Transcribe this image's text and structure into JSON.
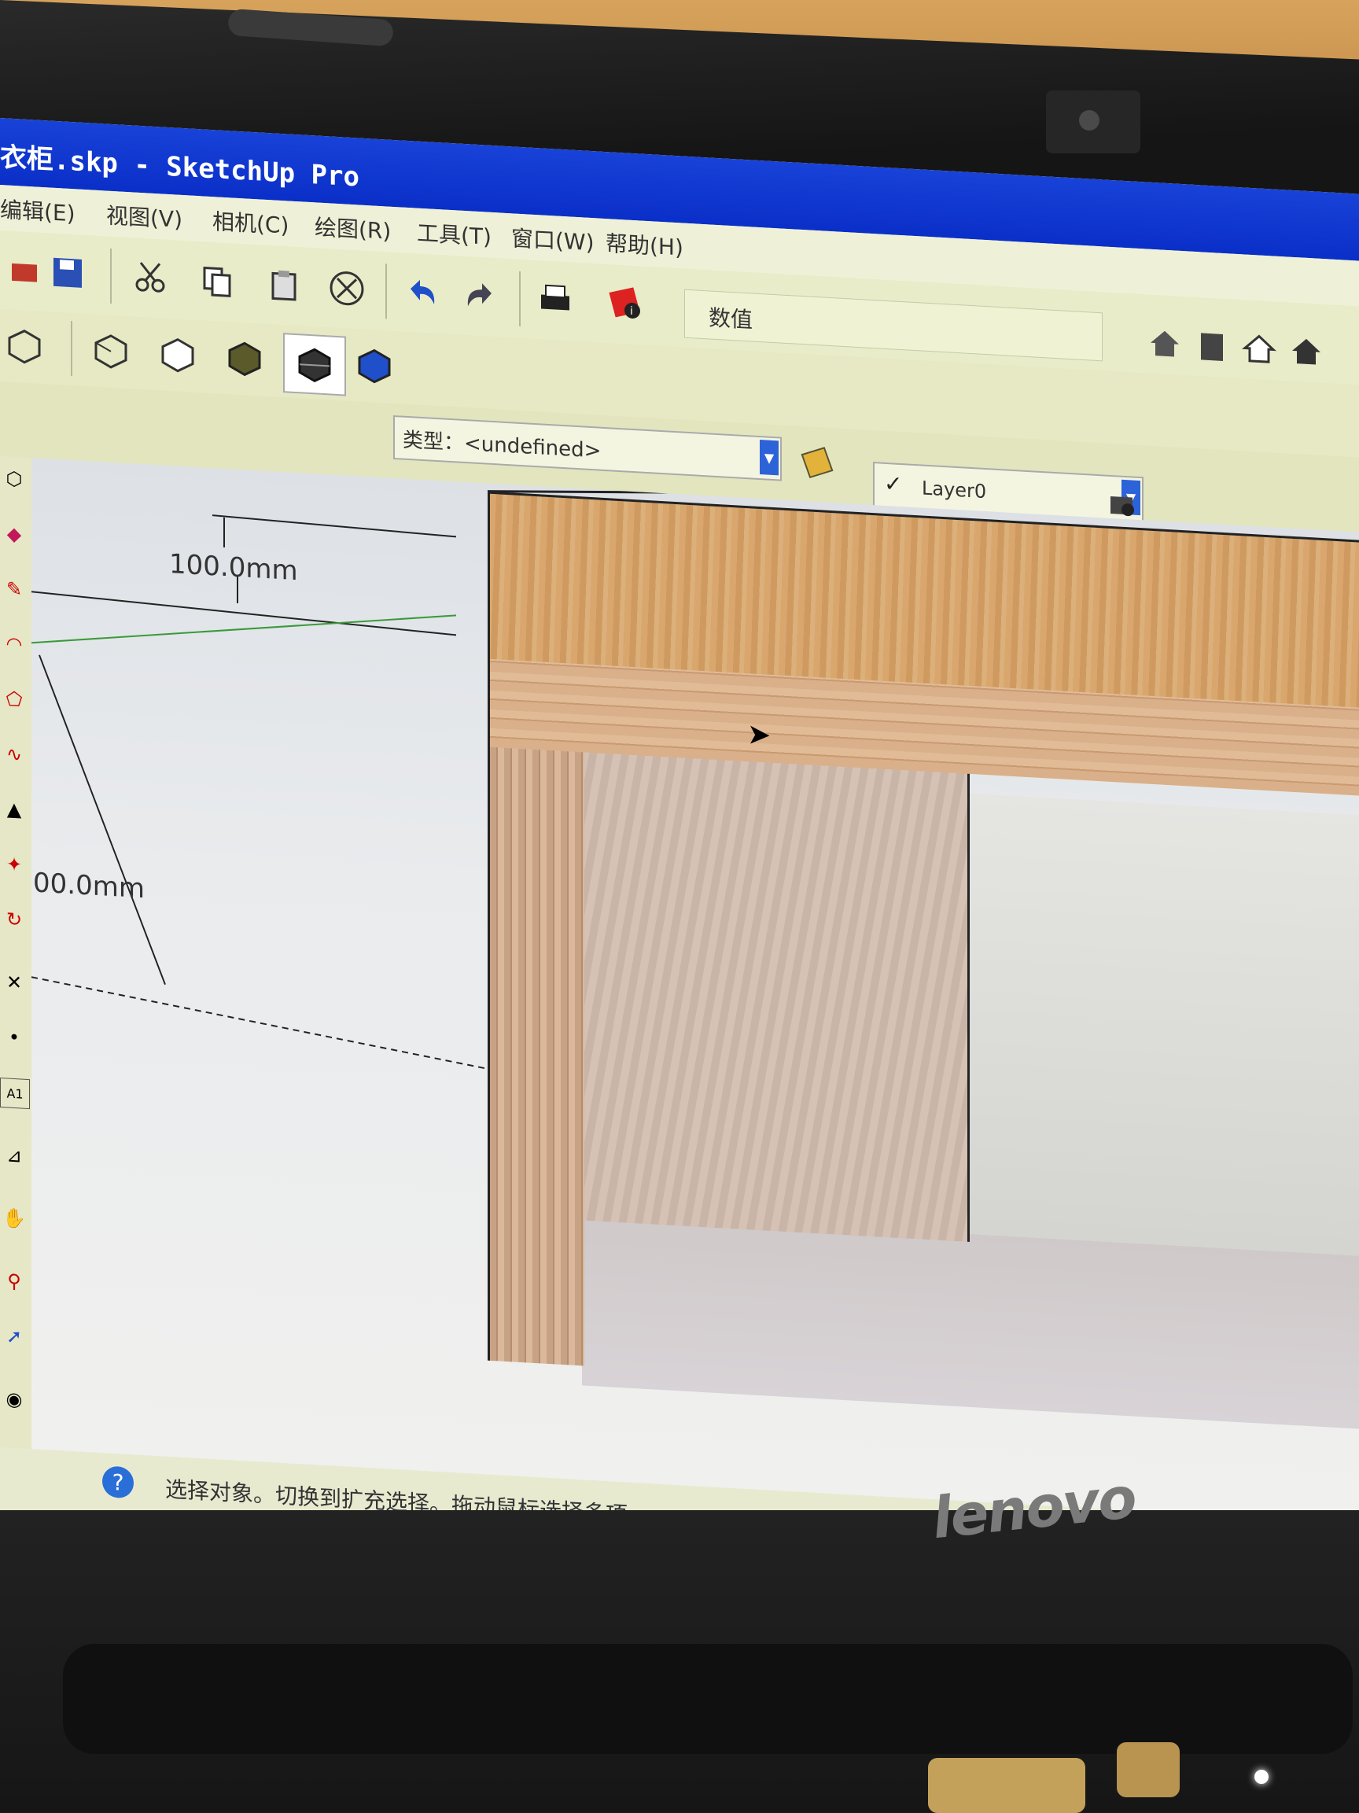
{
  "window": {
    "title": "衣柜.skp - SketchUp Pro"
  },
  "menubar": {
    "items": [
      "编辑(E)",
      "视图(V)",
      "相机(C)",
      "绘图(R)",
      "工具(T)",
      "窗口(W)",
      "帮助(H)"
    ]
  },
  "toolbar": {
    "value_label": "数值"
  },
  "entity_info": {
    "type_label": "类型：<undefined>",
    "layer_value": "Layer0"
  },
  "viewport": {
    "dimension_top": "100.0mm",
    "dimension_left": "00.0mm"
  },
  "statusbar": {
    "message": "选择对象。切换到扩充选择。拖动鼠标选择多项。"
  },
  "device": {
    "brand": "lenovo"
  },
  "colors": {
    "titlebar": "#0a2fc8",
    "wood": "#d9a66d",
    "ui_background": "#e6e8c8"
  }
}
